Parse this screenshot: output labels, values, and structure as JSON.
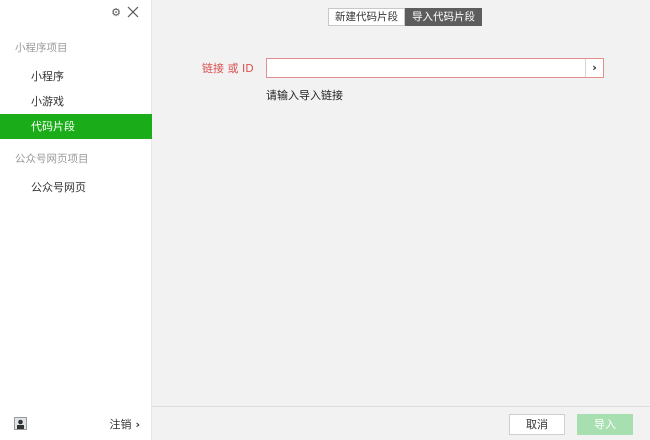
{
  "sidebar": {
    "sections": [
      {
        "title": "小程序项目",
        "items": [
          {
            "label": "小程序",
            "active": false
          },
          {
            "label": "小游戏",
            "active": false
          },
          {
            "label": "代码片段",
            "active": true
          }
        ]
      },
      {
        "title": "公众号网页项目",
        "items": [
          {
            "label": "公众号网页",
            "active": false
          }
        ]
      }
    ],
    "footer": {
      "logout_label": "注销",
      "logout_chevron": "›"
    },
    "window_controls": {
      "settings_icon": "gear-icon",
      "close_icon": "close-icon"
    }
  },
  "main": {
    "tabs": [
      {
        "label": "新建代码片段",
        "active": false
      },
      {
        "label": "导入代码片段",
        "active": true
      }
    ],
    "form": {
      "link_label": "链接 或 ID",
      "link_value": "",
      "go_symbol": "›",
      "hint": "请输入导入链接"
    },
    "footer": {
      "cancel_label": "取消",
      "import_label": "导入"
    }
  },
  "colors": {
    "accent_green": "#1aad19",
    "error_red": "#d9534f",
    "disabled_green": "#a8dfb0",
    "active_tab": "#5d5d5d"
  }
}
